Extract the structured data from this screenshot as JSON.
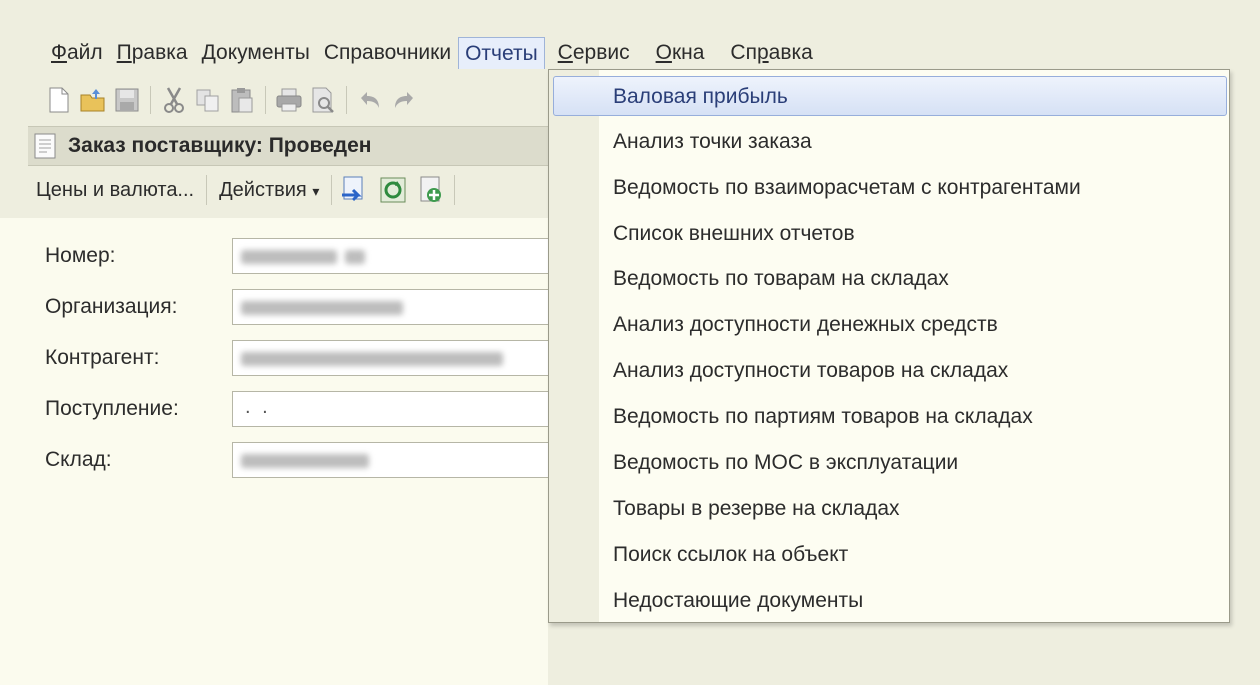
{
  "menubar": {
    "items": [
      {
        "pre": "",
        "u": "Ф",
        "post": "айл"
      },
      {
        "pre": "",
        "u": "П",
        "post": "равка"
      },
      {
        "pre": "Документы",
        "u": "",
        "post": ""
      },
      {
        "pre": "Справочники",
        "u": "",
        "post": ""
      },
      {
        "pre": "Отчеты",
        "u": "",
        "post": ""
      },
      {
        "pre": "",
        "u": "С",
        "post": "ервис"
      },
      {
        "pre": "",
        "u": "О",
        "post": "кна"
      },
      {
        "pre": "Сп",
        "u": "р",
        "post": "авка"
      }
    ],
    "active_index": 4
  },
  "toolbar": {
    "icons": [
      "new-document-icon",
      "open-folder-icon",
      "save-icon",
      "cut-icon",
      "copy-icon",
      "paste-icon",
      "print-icon",
      "print-preview-icon",
      "undo-icon",
      "redo-icon"
    ]
  },
  "document": {
    "title": "Заказ поставщику: Проведен",
    "toolbar": {
      "prices_label": "Цены и валюта...",
      "actions_label": "Действия",
      "actions_arrow": "▾"
    }
  },
  "form": {
    "fields": [
      {
        "label": "Номер:",
        "value": ""
      },
      {
        "label": "Организация:",
        "value": ""
      },
      {
        "label": "Контрагент:",
        "value": ""
      },
      {
        "label": "Поступление:",
        "value": ". ."
      },
      {
        "label": "Склад:",
        "value": ""
      }
    ]
  },
  "reports_menu": {
    "items": [
      "Валовая прибыль",
      "Анализ точки заказа",
      "Ведомость по взаиморасчетам с контрагентами",
      "Список внешних отчетов",
      "Ведомость по товарам на складах",
      "Анализ доступности денежных средств",
      "Анализ доступности товаров на складах",
      "Ведомость по партиям товаров на складах",
      "Ведомость по МОС в эксплуатации",
      "Товары в резерве на складах",
      "Поиск ссылок на объект",
      "Недостающие документы"
    ],
    "highlighted_index": 0
  },
  "colors": {
    "highlight": "#d6e1f5",
    "highlight_border": "#97aedb",
    "background": "#eeeedf"
  }
}
